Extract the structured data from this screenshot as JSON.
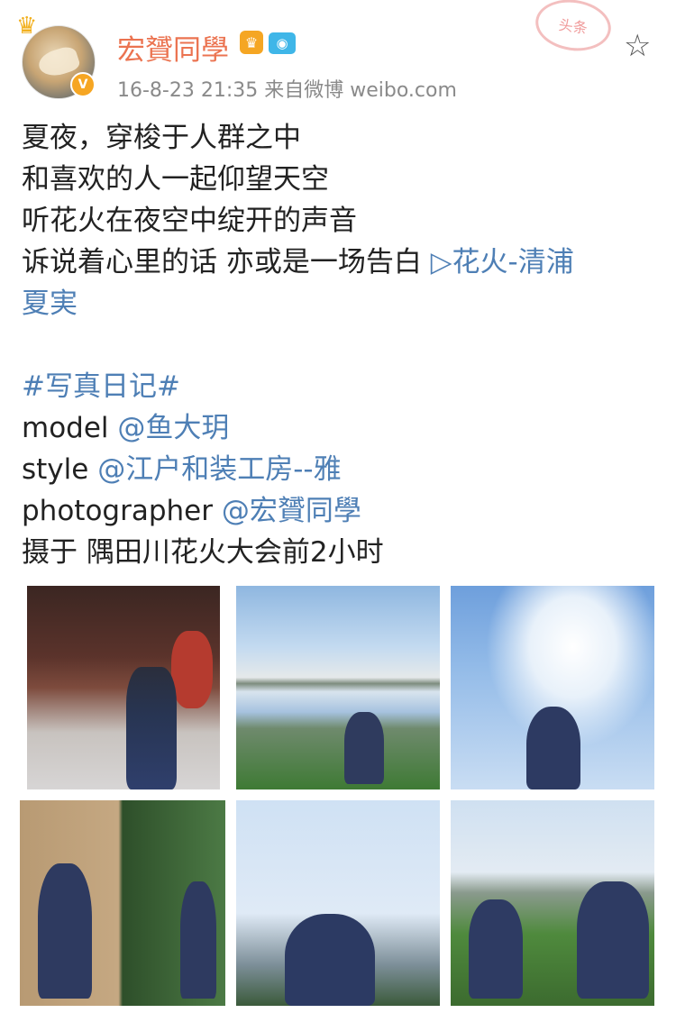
{
  "post": {
    "username": "宏贇同學",
    "meta": "16-8-23 21:35  来自微博 weibo.com",
    "stamp_text": "头条",
    "lines": [
      "夏夜，穿梭于人群之中",
      "和喜欢的人一起仰望天空",
      "听花火在夜空中绽开的声音",
      "诉说着心里的话 亦或是一场告白 "
    ],
    "music_link_line1": "▷花火-清浦",
    "music_link_line2": "夏実",
    "hashtag": "#写真日记#",
    "model_label": "model ",
    "model_mention": "@鱼大玥",
    "style_label": "style ",
    "style_mention": "@江户和装工房--雅",
    "photographer_label": "photographer ",
    "photographer_mention": "@宏贇同學",
    "location_line": "摄于 隅田川花火大会前2小时"
  },
  "icons": {
    "crown": "crown-icon",
    "verified": "verified-badge-icon",
    "vip": "vip-icon",
    "camera": "camera-icon",
    "star": "star-icon"
  },
  "colors": {
    "username": "#eb7350",
    "link": "#4e7fb5",
    "meta": "#8a8a8a"
  },
  "gallery": {
    "count": 6
  }
}
